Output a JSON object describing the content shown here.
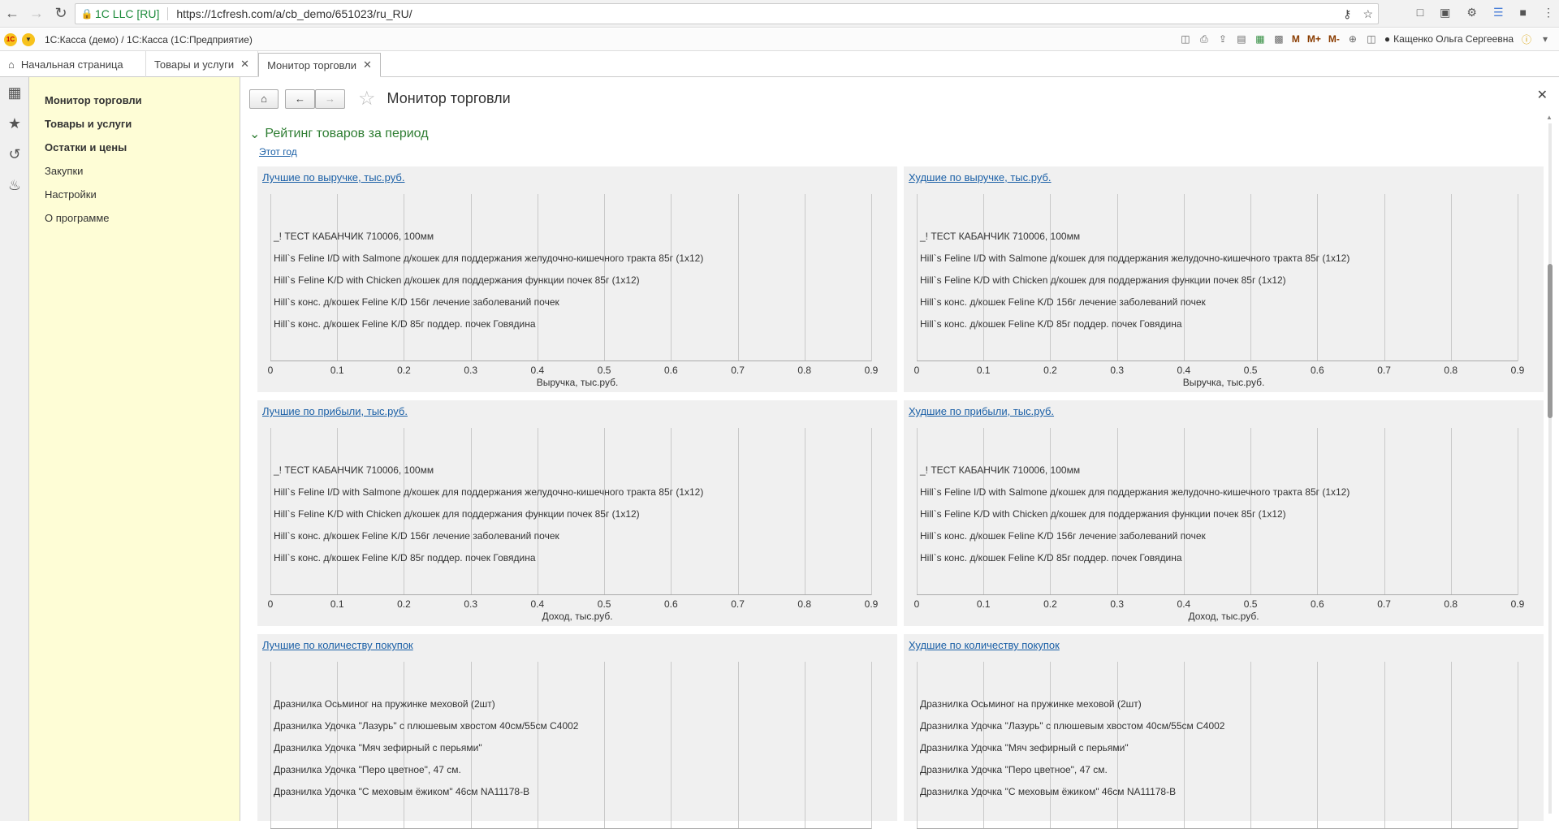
{
  "browser": {
    "site_label": "1C LLC [RU]",
    "url": "https://1cfresh.com/a/cb_demo/651023/ru_RU/"
  },
  "app": {
    "title": "1С:Касса (демо) / 1С:Касса   (1С:Предприятие)",
    "tools": [
      "M",
      "M+",
      "M-"
    ],
    "user": "Кащенко Ольга Сергеевна"
  },
  "tabs": {
    "home": "Начальная страница",
    "items": [
      "Товары и услуги",
      "Монитор торговли"
    ]
  },
  "sections": [
    "Монитор торговли",
    "Товары и услуги",
    "Остатки и цены",
    "Закупки",
    "Настройки",
    "О программе"
  ],
  "form": {
    "title": "Монитор торговли",
    "group_title": "Рейтинг товаров за период",
    "period": "Этот год"
  },
  "colors": {
    "panel_bg": "#f0f0f0",
    "link": "#1a5fa6",
    "group_green": "#2e7d32",
    "section_bg": "#fefdd6"
  },
  "chart_data": [
    {
      "type": "bar",
      "title": "Лучшие по выручке, тыс.руб.",
      "xlabel": "Выручка, тыс.руб.",
      "ticks": [
        "0",
        "0.1",
        "0.2",
        "0.3",
        "0.4",
        "0.5",
        "0.6",
        "0.7",
        "0.8",
        "0.9"
      ],
      "xlim": [
        0,
        0.9
      ],
      "categories": [
        "_! ТЕСТ КАБАНЧИК 710006, 100мм",
        "Hill`s Feline I/D with Salmone д/кошек для поддержания желудочно-кишечного тракта 85г (1x12)",
        "Hill`s Feline K/D with Chicken д/кошек для поддержания функции почек 85г (1x12)",
        "Hill`s конс. д/кошек Feline K/D 156г лечение заболеваний почек",
        "Hill`s конс. д/кошек Feline K/D 85г поддер. почек Говядина"
      ],
      "values": [
        0,
        0,
        0,
        0,
        0
      ]
    },
    {
      "type": "bar",
      "title": "Худшие по выручке, тыс.руб.",
      "xlabel": "Выручка, тыс.руб.",
      "ticks": [
        "0",
        "0.1",
        "0.2",
        "0.3",
        "0.4",
        "0.5",
        "0.6",
        "0.7",
        "0.8",
        "0.9"
      ],
      "xlim": [
        0,
        0.9
      ],
      "categories": [
        "_! ТЕСТ КАБАНЧИК 710006, 100мм",
        "Hill`s Feline I/D with Salmone д/кошек для поддержания желудочно-кишечного тракта 85г (1x12)",
        "Hill`s Feline K/D with Chicken д/кошек для поддержания функции почек 85г (1x12)",
        "Hill`s конс. д/кошек Feline K/D 156г лечение заболеваний почек",
        "Hill`s конс. д/кошек Feline K/D 85г поддер. почек Говядина"
      ],
      "values": [
        0,
        0,
        0,
        0,
        0
      ]
    },
    {
      "type": "bar",
      "title": "Лучшие по прибыли, тыс.руб.",
      "xlabel": "Доход, тыс.руб.",
      "ticks": [
        "0",
        "0.1",
        "0.2",
        "0.3",
        "0.4",
        "0.5",
        "0.6",
        "0.7",
        "0.8",
        "0.9"
      ],
      "xlim": [
        0,
        0.9
      ],
      "categories": [
        "_! ТЕСТ КАБАНЧИК 710006, 100мм",
        "Hill`s Feline I/D with Salmone д/кошек для поддержания желудочно-кишечного тракта 85г (1x12)",
        "Hill`s Feline K/D with Chicken д/кошек для поддержания функции почек 85г (1x12)",
        "Hill`s конс. д/кошек Feline K/D 156г лечение заболеваний почек",
        "Hill`s конс. д/кошек Feline K/D 85г поддер. почек Говядина"
      ],
      "values": [
        0,
        0,
        0,
        0,
        0
      ]
    },
    {
      "type": "bar",
      "title": "Худшие по прибыли, тыс.руб.",
      "xlabel": "Доход, тыс.руб.",
      "ticks": [
        "0",
        "0.1",
        "0.2",
        "0.3",
        "0.4",
        "0.5",
        "0.6",
        "0.7",
        "0.8",
        "0.9"
      ],
      "xlim": [
        0,
        0.9
      ],
      "categories": [
        "_! ТЕСТ КАБАНЧИК 710006, 100мм",
        "Hill`s Feline I/D with Salmone д/кошек для поддержания желудочно-кишечного тракта 85г (1x12)",
        "Hill`s Feline K/D with Chicken д/кошек для поддержания функции почек 85г (1x12)",
        "Hill`s конс. д/кошек Feline K/D 156г лечение заболеваний почек",
        "Hill`s конс. д/кошек Feline K/D 85г поддер. почек Говядина"
      ],
      "values": [
        0,
        0,
        0,
        0,
        0
      ]
    },
    {
      "type": "bar",
      "title": "Лучшие по количеству покупок",
      "xlabel": "",
      "ticks": [],
      "xlim": [
        0,
        0.9
      ],
      "categories": [
        "Дразнилка Осьминог на пружинке меховой (2шт)",
        "Дразнилка Удочка \"Лазурь\" с плюшевым хвостом 40см/55см С4002",
        "Дразнилка Удочка \"Мяч зефирный с перьями\"",
        "Дразнилка Удочка \"Перо цветное\", 47 см.",
        "Дразнилка Удочка \"С меховым ёжиком\" 46см NA11178-B"
      ],
      "values": [
        0,
        0,
        0,
        0,
        0
      ]
    },
    {
      "type": "bar",
      "title": "Худшие по количеству покупок",
      "xlabel": "",
      "ticks": [],
      "xlim": [
        0,
        0.9
      ],
      "categories": [
        "Дразнилка Осьминог на пружинке меховой (2шт)",
        "Дразнилка Удочка \"Лазурь\" с плюшевым хвостом 40см/55см С4002",
        "Дразнилка Удочка \"Мяч зефирный с перьями\"",
        "Дразнилка Удочка \"Перо цветное\", 47 см.",
        "Дразнилка Удочка \"С меховым ёжиком\" 46см NA11178-B"
      ],
      "values": [
        0,
        0,
        0,
        0,
        0
      ]
    }
  ]
}
